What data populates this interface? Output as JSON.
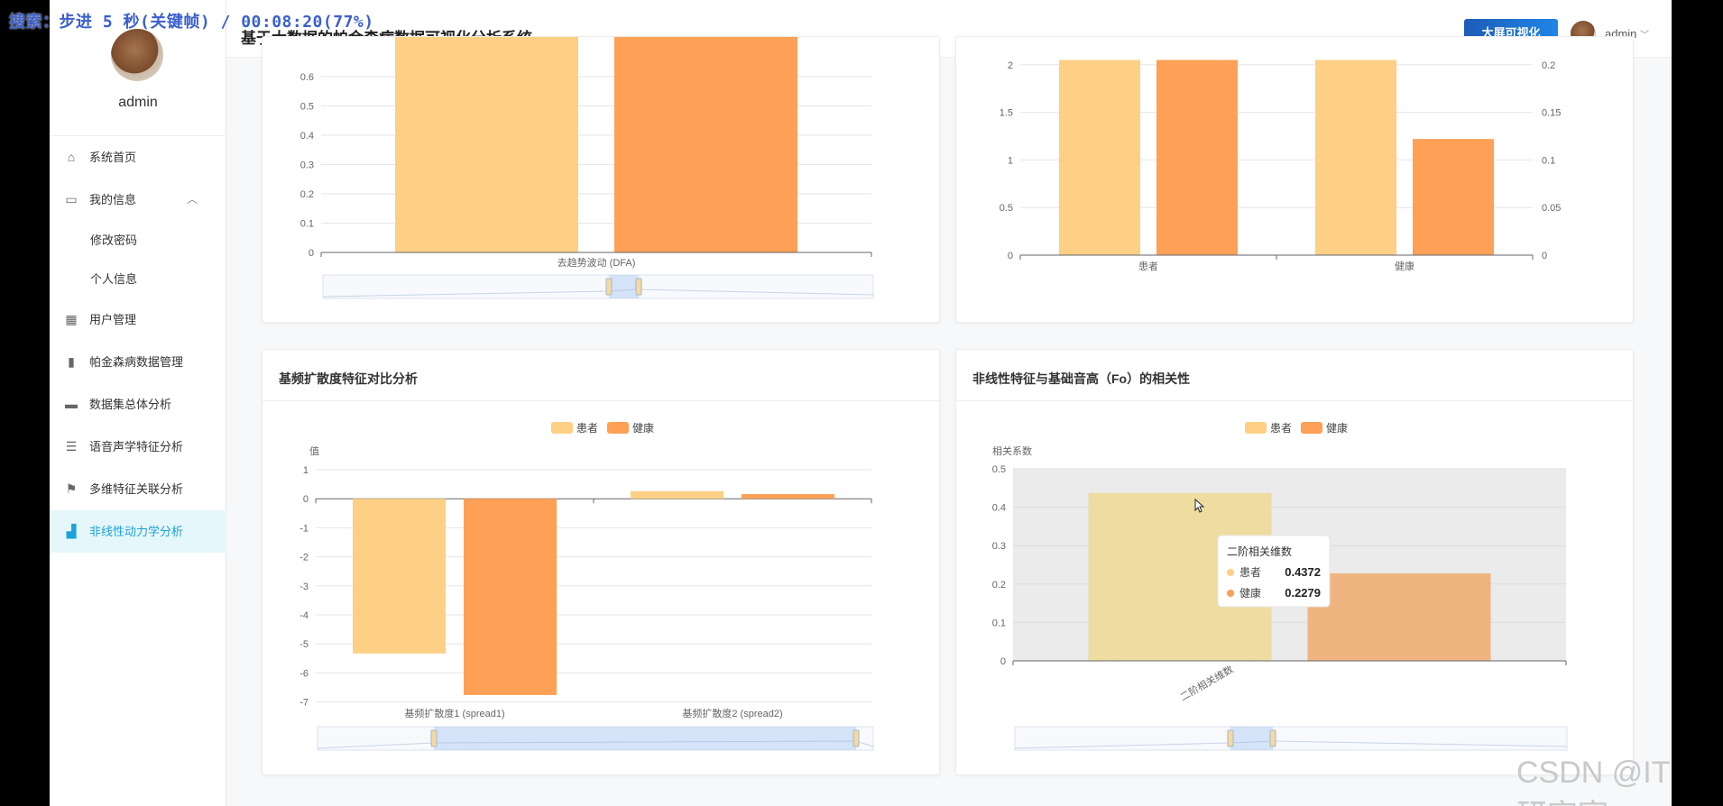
{
  "overlay": "搜索：步进 5 秒(关键帧) / 00:08:20(77%)",
  "app": {
    "title": "基于大数据的帕金森病数据可视化分析系统",
    "screen_btn": "大屏可视化",
    "user": "admin",
    "watermark": "CSDN @IT研究室"
  },
  "sidebar": {
    "user": "admin",
    "items": [
      {
        "label": "系统首页",
        "icon": "home-icon"
      },
      {
        "label": "我的信息",
        "icon": "card-icon"
      },
      {
        "label": "修改密码",
        "icon": ""
      },
      {
        "label": "个人信息",
        "icon": ""
      },
      {
        "label": "用户管理",
        "icon": "grid-icon"
      },
      {
        "label": "帕金森病数据管理",
        "icon": "bar-icon"
      },
      {
        "label": "数据集总体分析",
        "icon": "chat-icon"
      },
      {
        "label": "语音声学特征分析",
        "icon": "list-icon"
      },
      {
        "label": "多维特征关联分析",
        "icon": "flag-icon"
      },
      {
        "label": "非线性动力学分析",
        "icon": "chart-icon"
      }
    ]
  },
  "colors": {
    "patient": "#fdd085",
    "healthy": "#fea055",
    "accent": "#1aa3d9"
  },
  "chart_data": [
    {
      "type": "bar",
      "title": "",
      "categories": [
        "去趋势波动 (DFA)"
      ],
      "series": [
        {
          "values": [
            0.66
          ]
        },
        {
          "values": [
            0.66
          ]
        }
      ],
      "yticks": [
        "0",
        "0.1",
        "0.2",
        "0.3",
        "0.4",
        "0.5",
        "0.6"
      ],
      "ylim": [
        0,
        0.66
      ]
    },
    {
      "type": "bar",
      "title": "",
      "categories": [
        "患者",
        "健康"
      ],
      "series": [
        {
          "values": [
            2.05,
            2.05
          ]
        },
        {
          "values": [
            2.05,
            1.22
          ]
        }
      ],
      "yticks_left": [
        "0",
        "0.5",
        "1",
        "1.5",
        "2"
      ],
      "yticks_right": [
        "0",
        "0.05",
        "0.1",
        "0.15",
        "0.2"
      ],
      "ylim": [
        0,
        2.05
      ]
    },
    {
      "type": "bar",
      "title": "基频扩散度特征对比分析",
      "legend": [
        "患者",
        "健康"
      ],
      "ylabel": "值",
      "categories": [
        "基频扩散度1 (spread1)",
        "基频扩散度2 (spread2)"
      ],
      "series": [
        {
          "name": "患者",
          "values": [
            -5.33,
            0.26
          ]
        },
        {
          "name": "健康",
          "values": [
            -6.76,
            0.16
          ]
        }
      ],
      "yticks": [
        "1",
        "0",
        "-1",
        "-2",
        "-3",
        "-4",
        "-5",
        "-6",
        "-7"
      ],
      "ylim": [
        -7,
        1
      ]
    },
    {
      "type": "bar",
      "title": "非线性特征与基础音高（Fo）的相关性",
      "legend": [
        "患者",
        "健康"
      ],
      "ylabel": "相关系数",
      "categories": [
        "二阶相关维数"
      ],
      "series": [
        {
          "name": "患者",
          "values": [
            0.4372
          ]
        },
        {
          "name": "健康",
          "values": [
            0.2279
          ]
        }
      ],
      "yticks": [
        "0",
        "0.1",
        "0.2",
        "0.3",
        "0.4",
        "0.5"
      ],
      "ylim": [
        0,
        0.5
      ],
      "tooltip": {
        "title": "二阶相关维数",
        "rows": [
          {
            "name": "患者",
            "value": "0.4372"
          },
          {
            "name": "健康",
            "value": "0.2279"
          }
        ]
      }
    }
  ]
}
